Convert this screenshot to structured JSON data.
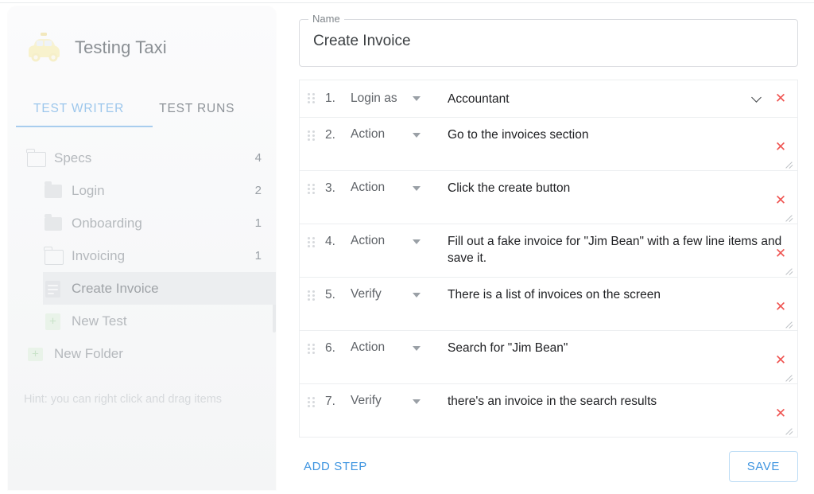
{
  "sidebar": {
    "brand": {
      "logo_icon": "taxi-icon",
      "title": "Testing Taxi"
    },
    "tabs": [
      {
        "label": "TEST WRITER",
        "active": true
      },
      {
        "label": "TEST RUNS",
        "active": false
      }
    ],
    "tree": [
      {
        "label": "Specs",
        "count": "4",
        "icon": "folder-open-icon",
        "indent": 0,
        "selected": false
      },
      {
        "label": "Login",
        "count": "2",
        "icon": "folder-closed-icon",
        "indent": 1,
        "selected": false
      },
      {
        "label": "Onboarding",
        "count": "1",
        "icon": "folder-closed-icon",
        "indent": 1,
        "selected": false
      },
      {
        "label": "Invoicing",
        "count": "1",
        "icon": "folder-open-icon",
        "indent": 1,
        "selected": false
      },
      {
        "label": "Create Invoice",
        "count": "",
        "icon": "test-document-icon",
        "indent": 2,
        "selected": true
      },
      {
        "label": "New Test",
        "count": "",
        "icon": "new-test-icon",
        "indent": 2,
        "selected": false
      },
      {
        "label": "New Folder",
        "count": "",
        "icon": "new-folder-icon",
        "indent": 1,
        "selected": false
      }
    ],
    "hint": "Hint: you can right click and drag items"
  },
  "main": {
    "name_field": {
      "legend": "Name",
      "value": "Create Invoice",
      "placeholder": "Name"
    },
    "steps": [
      {
        "index": "1.",
        "type": "Login as",
        "text": "Accountant",
        "has_select_chevron": true,
        "has_resize_grip": false,
        "delete_icon": "close-icon"
      },
      {
        "index": "2.",
        "type": "Action",
        "text": "Go to the invoices section",
        "has_select_chevron": false,
        "has_resize_grip": true,
        "delete_icon": "close-icon"
      },
      {
        "index": "3.",
        "type": "Action",
        "text": "Click the create button",
        "has_select_chevron": false,
        "has_resize_grip": true,
        "delete_icon": "close-icon"
      },
      {
        "index": "4.",
        "type": "Action",
        "text": "Fill out a fake invoice for \"Jim Bean\" with a few line items and save it.",
        "has_select_chevron": false,
        "has_resize_grip": true,
        "delete_icon": "close-icon"
      },
      {
        "index": "5.",
        "type": "Verify",
        "text": "There is a list of invoices on the screen",
        "has_select_chevron": false,
        "has_resize_grip": true,
        "delete_icon": "close-icon"
      },
      {
        "index": "6.",
        "type": "Action",
        "text": "Search for \"Jim Bean\"",
        "has_select_chevron": false,
        "has_resize_grip": true,
        "delete_icon": "close-icon"
      },
      {
        "index": "7.",
        "type": "Verify",
        "text": "there's an invoice in the search results",
        "has_select_chevron": false,
        "has_resize_grip": true,
        "delete_icon": "close-icon"
      }
    ],
    "step_type_options": [
      "Login as",
      "Action",
      "Verify"
    ],
    "footer": {
      "add_step_label": "ADD STEP",
      "save_label": "SAVE"
    }
  },
  "colors": {
    "accent_blue": "#3d94e0",
    "tab_active": "#9dc7ec",
    "delete_red": "#ef5350",
    "taxi_yellow": "#f6e8a0",
    "text_primary": "#202124",
    "text_muted": "#9aa0a6",
    "border": "#eceef0"
  }
}
